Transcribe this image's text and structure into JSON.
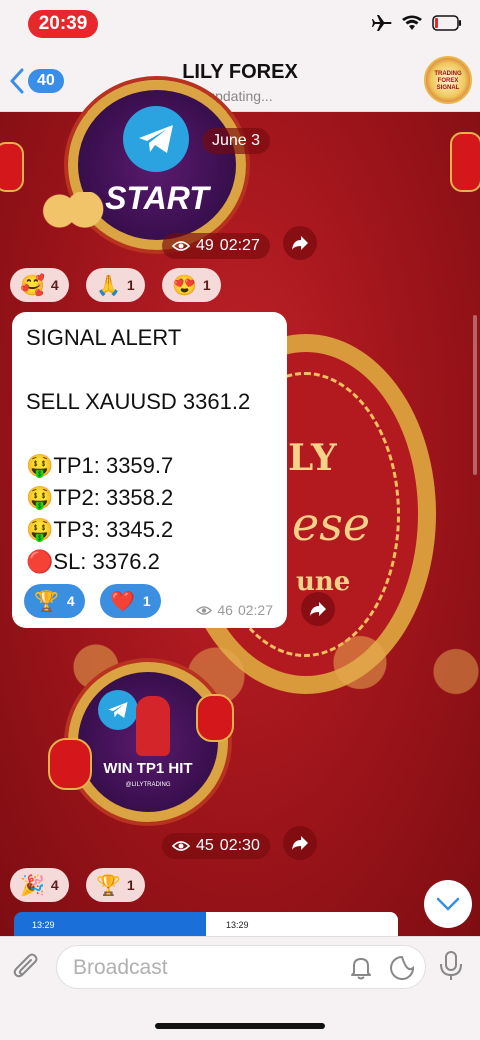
{
  "status_bar": {
    "time": "20:39"
  },
  "header": {
    "back_count": "40",
    "title": "LILY FOREX",
    "subtitle": "updating...",
    "avatar_text": "TRADING FOREX SIGNAL"
  },
  "feed": {
    "post1": {
      "badge_text": "START",
      "date_label": "June 3",
      "views": "49",
      "time": "02:27",
      "reactions": [
        {
          "emoji": "🥰",
          "count": "4"
        },
        {
          "emoji": "🙏",
          "count": "1"
        },
        {
          "emoji": "😍",
          "count": "1"
        }
      ]
    },
    "background_text": {
      "left": "LY",
      "middle": "ese",
      "bottom": "une"
    },
    "signal": {
      "line1": "SIGNAL ALERT",
      "line2": "SELL XAUUSD 3361.2",
      "tp1": "🤑TP1: 3359.7",
      "tp2": "🤑TP2: 3358.2",
      "tp3": "🤑TP3: 3345.2",
      "sl": "🔴SL: 3376.2",
      "reactions": [
        {
          "emoji": "🏆",
          "count": "4"
        },
        {
          "emoji": "❤️",
          "count": "1"
        }
      ],
      "views": "46",
      "time": "02:27"
    },
    "post2": {
      "badge_text": "WIN TP1 HIT",
      "badge_small": "@LILYTRADING",
      "views": "45",
      "time": "02:30",
      "reactions": [
        {
          "emoji": "🎉",
          "count": "4"
        },
        {
          "emoji": "🏆",
          "count": "1"
        }
      ]
    },
    "preview": {
      "left_time": "13:29",
      "right_time": "13:29"
    }
  },
  "composer": {
    "placeholder": "Broadcast"
  },
  "colors": {
    "accent": "#3b8fe0",
    "status_red": "#e8272d",
    "background_red": "#a3161c",
    "gold": "#d9a441"
  }
}
